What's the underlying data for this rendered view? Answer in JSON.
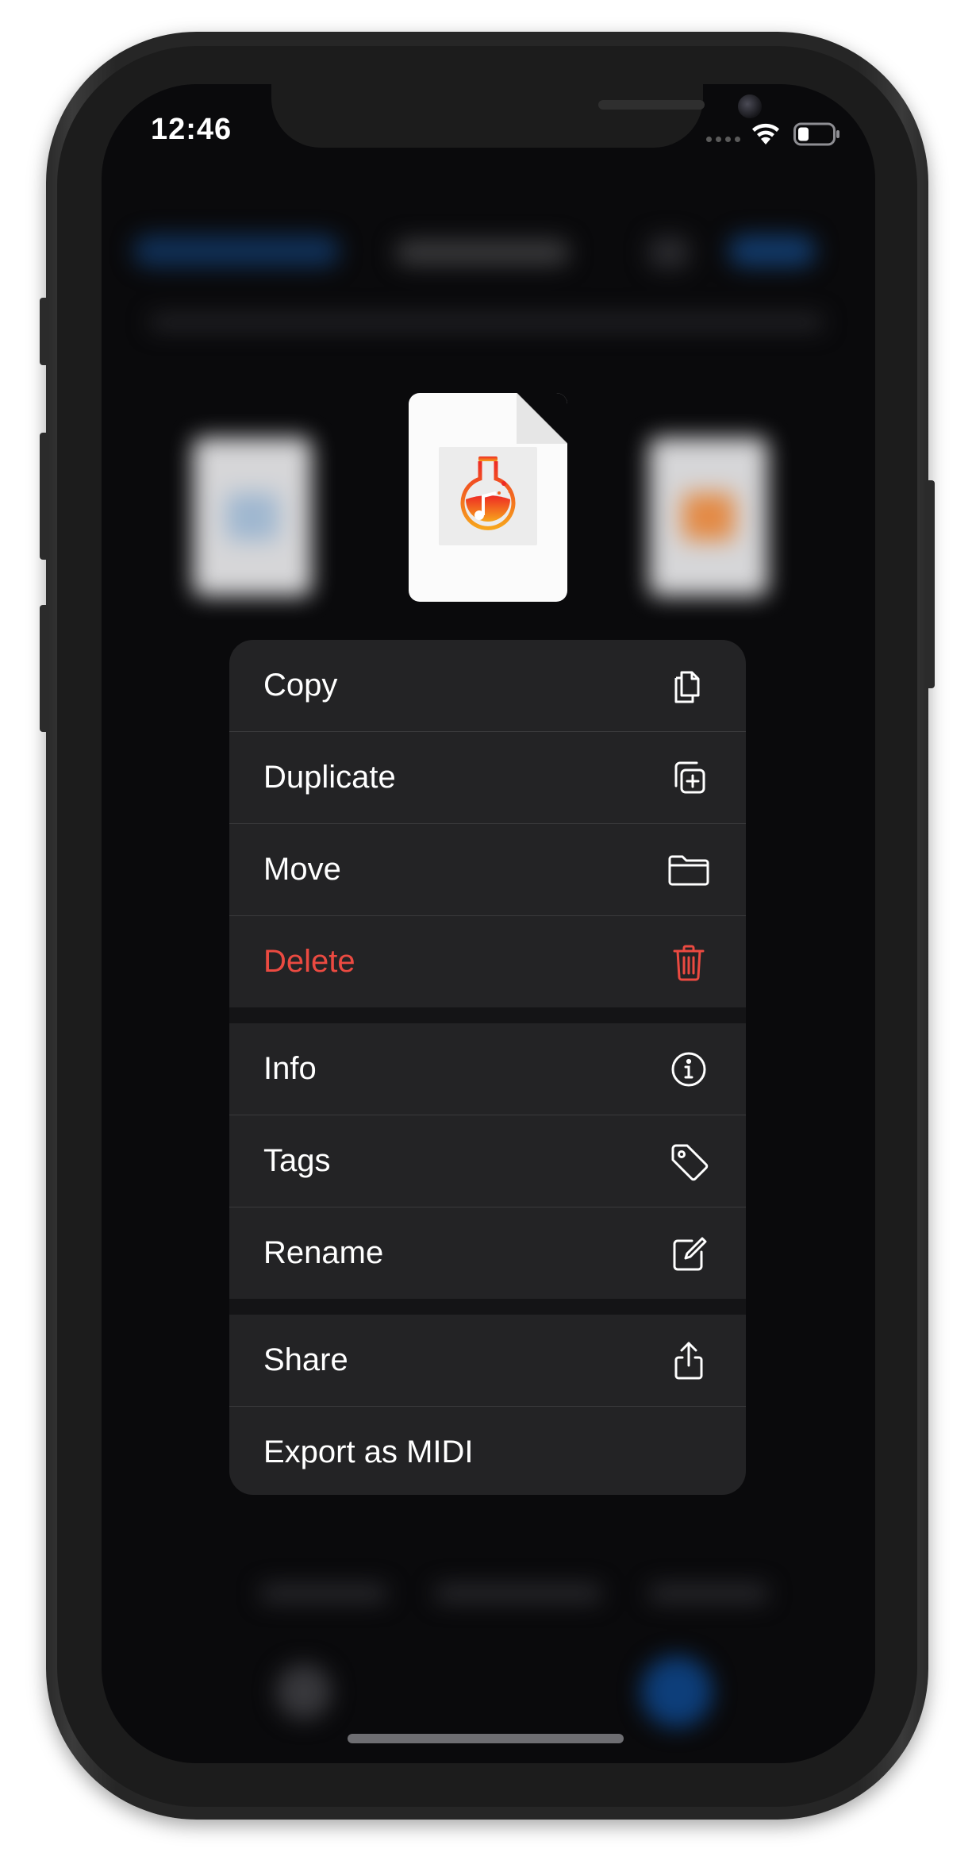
{
  "status_bar": {
    "time": "12:46"
  },
  "context_menu": {
    "groups": [
      {
        "items": [
          {
            "id": "copy",
            "label": "Copy",
            "icon": "copy-icon",
            "destructive": false
          },
          {
            "id": "duplicate",
            "label": "Duplicate",
            "icon": "duplicate-icon",
            "destructive": false
          },
          {
            "id": "move",
            "label": "Move",
            "icon": "folder-icon",
            "destructive": false
          },
          {
            "id": "delete",
            "label": "Delete",
            "icon": "trash-icon",
            "destructive": true
          }
        ]
      },
      {
        "items": [
          {
            "id": "info",
            "label": "Info",
            "icon": "info-icon",
            "destructive": false
          },
          {
            "id": "tags",
            "label": "Tags",
            "icon": "tag-icon",
            "destructive": false
          },
          {
            "id": "rename",
            "label": "Rename",
            "icon": "rename-icon",
            "destructive": false
          }
        ]
      },
      {
        "items": [
          {
            "id": "share",
            "label": "Share",
            "icon": "share-icon",
            "destructive": false
          },
          {
            "id": "export-midi",
            "label": "Export as MIDI",
            "icon": "",
            "destructive": false
          }
        ]
      }
    ]
  },
  "file_preview": {
    "icon": "music-flask-icon"
  },
  "colors": {
    "destructive": "#eb4a41",
    "menu_background": "#232325",
    "accent_gradient_top": "#ee2a24",
    "accent_gradient_bottom": "#f7a51c"
  }
}
